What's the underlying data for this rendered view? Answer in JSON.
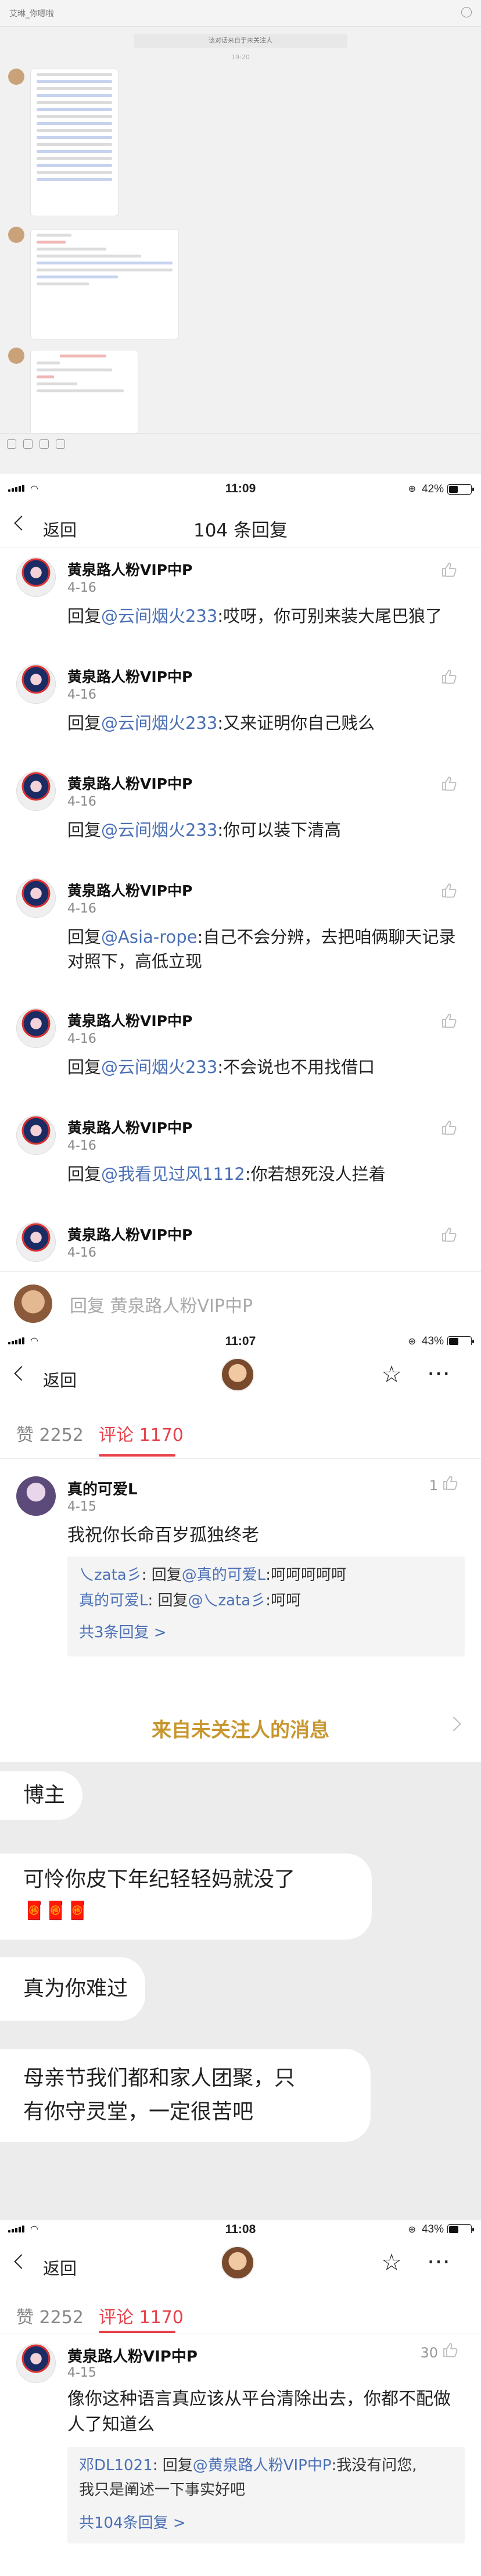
{
  "chat": {
    "title": "艾琳_你嗯啦",
    "notice": "该对话来自于未关注人",
    "time": "19:20"
  },
  "status1": {
    "time": "11:09",
    "battery": "42%",
    "battery_level": 0.42
  },
  "replies_header": {
    "back": "返回",
    "title": "104 条回复"
  },
  "replies": [
    {
      "name": "黄泉路人粉VIP中P",
      "date": "4-16",
      "prefix": "回复",
      "mention": "@云间烟火233",
      "text": ":哎呀，你可别来装大尾巴狼了"
    },
    {
      "name": "黄泉路人粉VIP中P",
      "date": "4-16",
      "prefix": "回复",
      "mention": "@云间烟火233",
      "text": ":又来证明你自己贱么"
    },
    {
      "name": "黄泉路人粉VIP中P",
      "date": "4-16",
      "prefix": "回复",
      "mention": "@云间烟火233",
      "text": ":你可以装下清高"
    },
    {
      "name": "黄泉路人粉VIP中P",
      "date": "4-16",
      "prefix": "回复",
      "mention": "@Asia-rope",
      "text": ":自己不会分辨，去把咱俩聊天记录对照下，高低立现"
    },
    {
      "name": "黄泉路人粉VIP中P",
      "date": "4-16",
      "prefix": "回复",
      "mention": "@云间烟火233",
      "text": ":不会说也不用找借口"
    },
    {
      "name": "黄泉路人粉VIP中P",
      "date": "4-16",
      "prefix": "回复",
      "mention": "@我看见过风1112",
      "text": ":你若想死没人拦着"
    },
    {
      "name": "黄泉路人粉VIP中P",
      "date": "4-16",
      "prefix": "",
      "mention": "",
      "text": ""
    }
  ],
  "reply_input": {
    "placeholder": "回复 黄泉路人粉VIP中P"
  },
  "status2": {
    "time": "11:07",
    "battery": "43%",
    "battery_level": 0.43
  },
  "post1": {
    "back": "返回",
    "likes_tab": "赞 2252",
    "comments_tab": "评论 1170",
    "comment": {
      "name": "真的可爱L",
      "date": "4-15",
      "likes": "1",
      "text": "我祝你长命百岁孤独终老",
      "subs": [
        {
          "user": "乀zata彡",
          "sep": ": 回复",
          "mention": "@真的可爱L",
          "text": ":呵呵呵呵呵"
        },
        {
          "user": "真的可爱L",
          "sep": ": 回复",
          "mention": "@乀zata彡",
          "text": ":呵呵"
        }
      ],
      "more": "共3条回复 >"
    }
  },
  "messages": {
    "header": "来自未关注人的消息",
    "bubbles": [
      "博主",
      "可怜你皮下年纪轻轻妈就没了",
      "真为你难过",
      "母亲节我们都和家人团聚，只",
      "有你守灵堂，一定很苦吧"
    ]
  },
  "status3": {
    "time": "11:08",
    "battery": "43%",
    "battery_level": 0.43
  },
  "post2": {
    "back": "返回",
    "likes_tab": "赞 2252",
    "comments_tab": "评论 1170",
    "comment": {
      "name": "黄泉路人粉VIP中P",
      "date": "4-15",
      "likes": "30",
      "text1": "像你这种语言真应该从平台清除出去，你都不配做",
      "text2": "人了知道么",
      "sub_user": "邓DL1021",
      "sub_sep": ": 回复",
      "sub_mention": "@黄泉路人粉VIP中P",
      "sub_text1": ":我没有问您,",
      "sub_text2": "我只是阐述一下事实好吧",
      "more": "共104条回复 >"
    }
  }
}
